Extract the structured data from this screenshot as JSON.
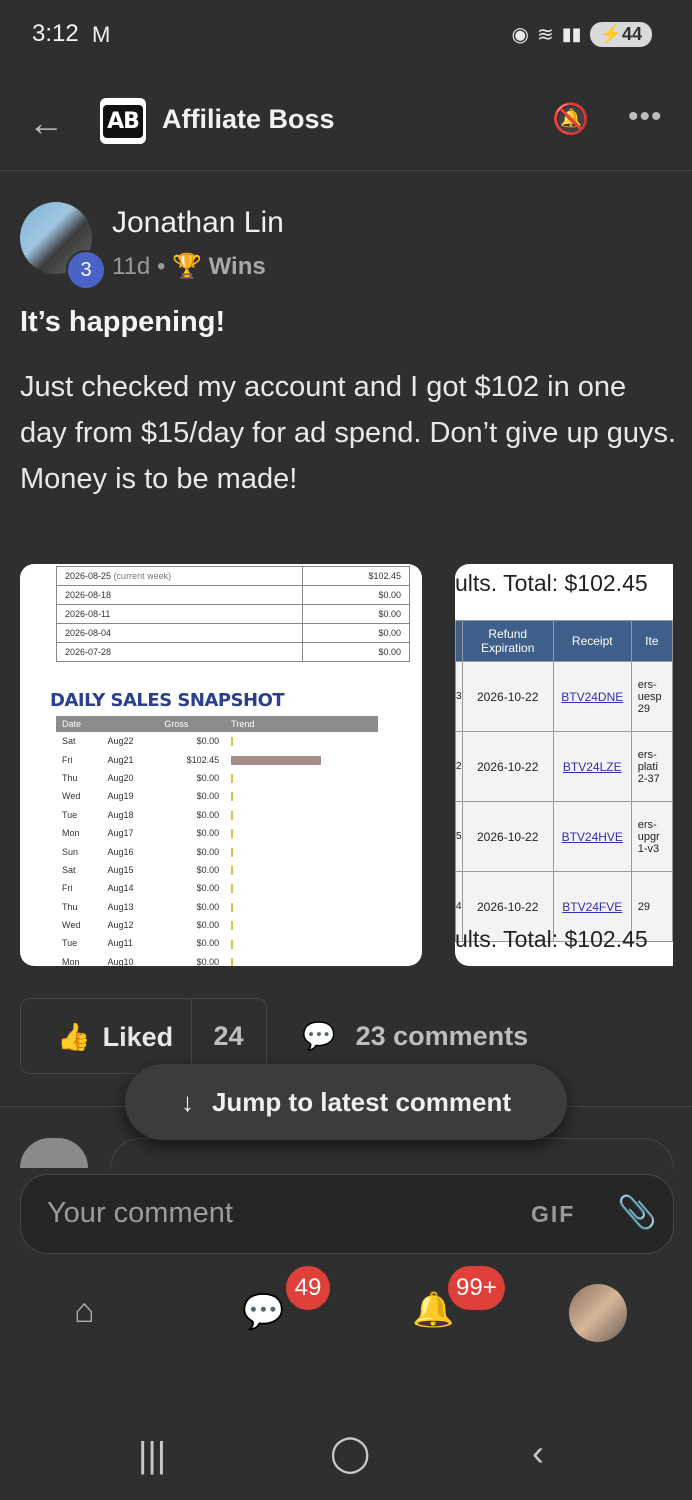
{
  "status_bar": {
    "time": "3:12",
    "battery": "44",
    "colors": {
      "bg": "#2f2f2f"
    }
  },
  "header": {
    "logo": "AB",
    "title": "Affiliate Boss"
  },
  "post": {
    "author": "Jonathan Lin",
    "level": "3",
    "age": "11d",
    "separator": "•",
    "category_icon": "🏆",
    "category": "Wins",
    "title": "It’s happening!",
    "body": "Just checked my account and I got $102 in one day from $15/day for ad spend. Don’t give up guys. Money is to be made!"
  },
  "image1": {
    "weekly_rows": [
      {
        "date": "2026-08-25",
        "note": "(current week)",
        "amount": "$102.45"
      },
      {
        "date": "2026-08-18",
        "note": "",
        "amount": "$0.00"
      },
      {
        "date": "2026-08-11",
        "note": "",
        "amount": "$0.00"
      },
      {
        "date": "2026-08-04",
        "note": "",
        "amount": "$0.00"
      },
      {
        "date": "2026-07-28",
        "note": "",
        "amount": "$0.00"
      }
    ],
    "snapshot_title": "DAILY SALES SNAPSHOT",
    "headers": {
      "date": "Date",
      "gross": "Gross",
      "trend": "Trend"
    },
    "daily_rows": [
      {
        "day": "Sat",
        "date": "Aug22",
        "gross": "$0.00",
        "trend": 0
      },
      {
        "day": "Fri",
        "date": "Aug21",
        "gross": "$102.45",
        "trend": 1
      },
      {
        "day": "Thu",
        "date": "Aug20",
        "gross": "$0.00",
        "trend": 0
      },
      {
        "day": "Wed",
        "date": "Aug19",
        "gross": "$0.00",
        "trend": 0
      },
      {
        "day": "Tue",
        "date": "Aug18",
        "gross": "$0.00",
        "trend": 0
      },
      {
        "day": "Mon",
        "date": "Aug17",
        "gross": "$0.00",
        "trend": 0
      },
      {
        "day": "Sun",
        "date": "Aug16",
        "gross": "$0.00",
        "trend": 0
      },
      {
        "day": "Sat",
        "date": "Aug15",
        "gross": "$0.00",
        "trend": 0
      },
      {
        "day": "Fri",
        "date": "Aug14",
        "gross": "$0.00",
        "trend": 0
      },
      {
        "day": "Thu",
        "date": "Aug13",
        "gross": "$0.00",
        "trend": 0
      },
      {
        "day": "Wed",
        "date": "Aug12",
        "gross": "$0.00",
        "trend": 0
      },
      {
        "day": "Tue",
        "date": "Aug11",
        "gross": "$0.00",
        "trend": 0
      },
      {
        "day": "Mon",
        "date": "Aug10",
        "gross": "$0.00",
        "trend": 0
      }
    ]
  },
  "image2": {
    "header_text": "ults.   Total: $102.45",
    "col_refund": "Refund Expiration",
    "col_receipt": "Receipt",
    "col_item": "Ite",
    "rows": [
      {
        "lead": "3",
        "expiration": "2026-10-22",
        "receipt": "BTV24DNE",
        "item": "ers- uesp 29"
      },
      {
        "lead": "2",
        "expiration": "2026-10-22",
        "receipt": "BTV24LZE",
        "item": "ers- plati 2-37"
      },
      {
        "lead": "5",
        "expiration": "2026-10-22",
        "receipt": "BTV24HVE",
        "item": "ers- upgr 1-v3"
      },
      {
        "lead": "4",
        "expiration": "2026-10-22",
        "receipt": "BTV24FVE",
        "item": "29"
      }
    ],
    "footer_text": "ults.   Total: $102.45"
  },
  "actions": {
    "liked_label": "Liked",
    "like_count": "24",
    "comments_label": "23 comments",
    "jump_label": "Jump to latest comment"
  },
  "composer": {
    "placeholder": "Your comment",
    "gif_label": "GIF"
  },
  "nav": {
    "chat_badge": "49",
    "notif_badge": "99+"
  }
}
